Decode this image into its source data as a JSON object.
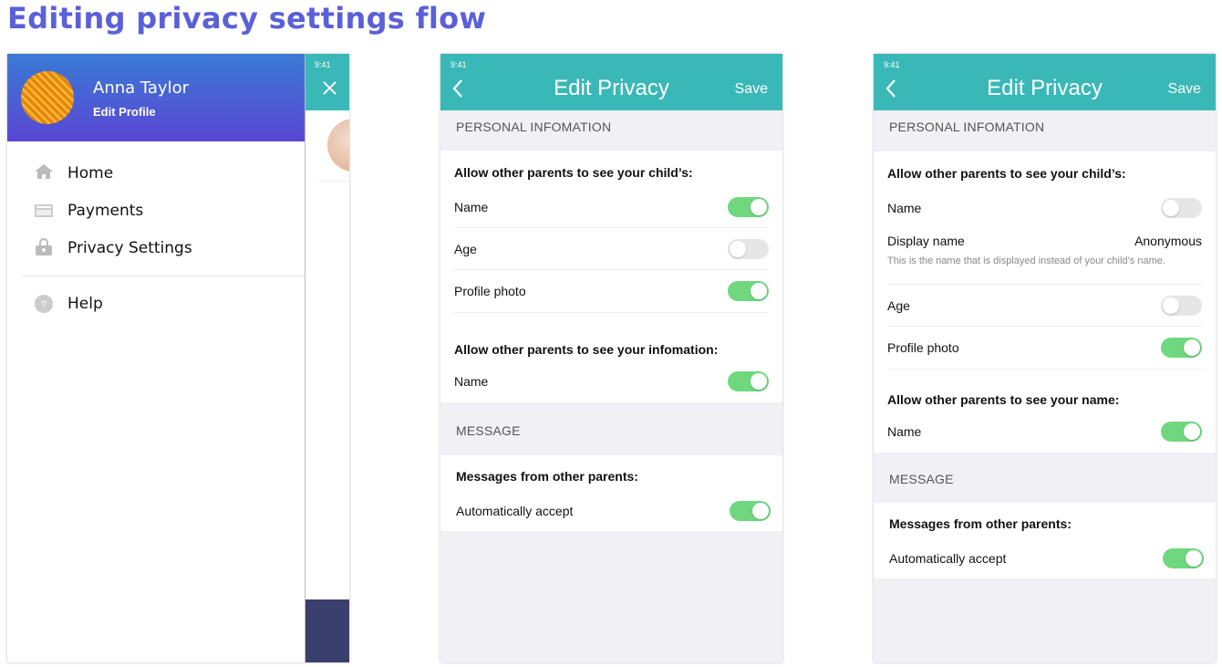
{
  "title": "Editing privacy settings flow",
  "colors": {
    "accent": "#5b60d8",
    "header_teal": "#3ab8b8",
    "toggle_on": "#6fd87f",
    "toggle_off": "#e6e6e6",
    "drawer_gradient_top": "#3a7bd5",
    "drawer_gradient_bottom": "#5a46d4",
    "navy": "#3b3f6e"
  },
  "drawer": {
    "status_time": "9:41",
    "user_name": "Anna Taylor",
    "edit_profile": "Edit Profile",
    "items": [
      {
        "label": "Home",
        "icon": "home-icon"
      },
      {
        "label": "Payments",
        "icon": "credit-card-icon"
      },
      {
        "label": "Privacy Settings",
        "icon": "lock-icon"
      },
      {
        "label": "Help",
        "icon": "help-icon"
      }
    ]
  },
  "screen2": {
    "status_time": "9:41",
    "title": "Edit Privacy",
    "save": "Save",
    "section_personal": "PERSONAL INFOMATION",
    "child_heading": "Allow other parents to see your child’s:",
    "child_rows": [
      {
        "label": "Name",
        "on": true
      },
      {
        "label": "Age",
        "on": false
      },
      {
        "label": "Profile photo",
        "on": true
      }
    ],
    "you_heading": "Allow other parents to see your infomation:",
    "you_rows": [
      {
        "label": "Name",
        "on": true
      }
    ],
    "section_message": "MESSAGE",
    "msg_heading": "Messages from other parents:",
    "msg_rows": [
      {
        "label": "Automatically accept",
        "on": true
      }
    ]
  },
  "screen3": {
    "status_time": "9:41",
    "title": "Edit Privacy",
    "save": "Save",
    "section_personal": "PERSONAL INFOMATION",
    "child_heading": "Allow other parents to see your child’s:",
    "child_name": {
      "label": "Name",
      "on": false
    },
    "display_name": {
      "label": "Display name",
      "value": "Anonymous",
      "hint": "This is the name that is displayed instead of your child’s name."
    },
    "child_rows": [
      {
        "label": "Age",
        "on": false
      },
      {
        "label": "Profile photo",
        "on": true
      }
    ],
    "you_heading": "Allow other parents to see your name:",
    "you_rows": [
      {
        "label": "Name",
        "on": true
      }
    ],
    "section_message": "MESSAGE",
    "msg_heading": "Messages from other parents:",
    "msg_rows": [
      {
        "label": "Automatically accept",
        "on": true
      }
    ]
  }
}
